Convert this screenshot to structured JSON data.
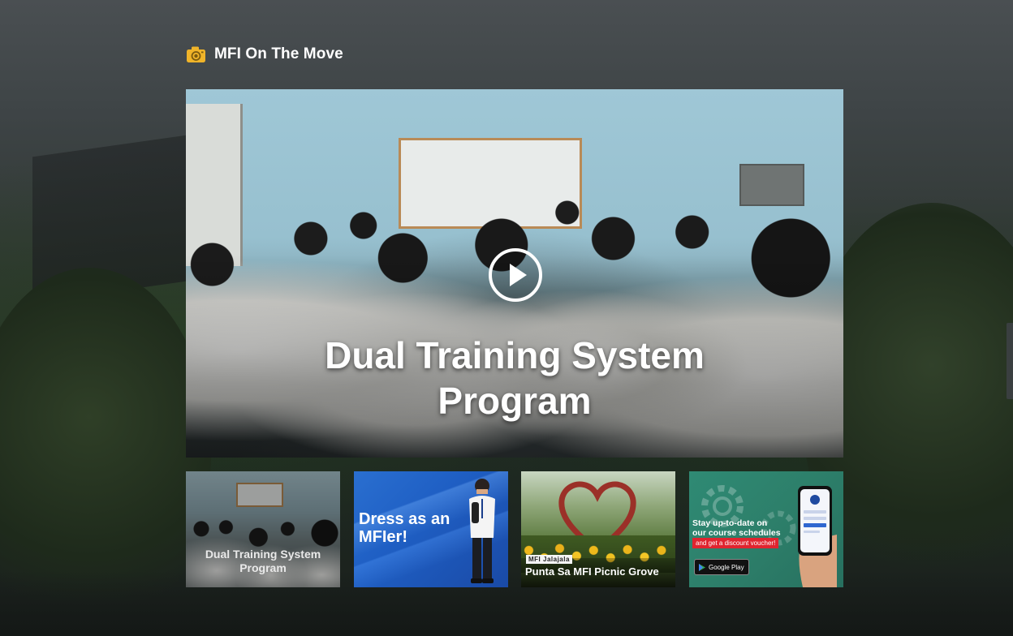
{
  "section": {
    "title": "MFI On The Move",
    "icon": "camera-icon",
    "accent_color": "#f0b429"
  },
  "featured": {
    "title_line1": "Dual Training System",
    "title_line2": "Program",
    "play_icon": "play-icon"
  },
  "thumbnails": [
    {
      "title_line1": "Dual Training System",
      "title_line2": "Program"
    },
    {
      "title_line1": "Dress as an",
      "title_line2": "MFIer!"
    },
    {
      "tag": "MFI Jalajala",
      "title": "Punta Sa MFI Picnic Grove"
    },
    {
      "line1": "Stay up-to-date on",
      "line2": "our course schedules",
      "voucher": "and get a discount voucher!",
      "store": "Google Play",
      "voucher_color": "#e0242f"
    }
  ]
}
